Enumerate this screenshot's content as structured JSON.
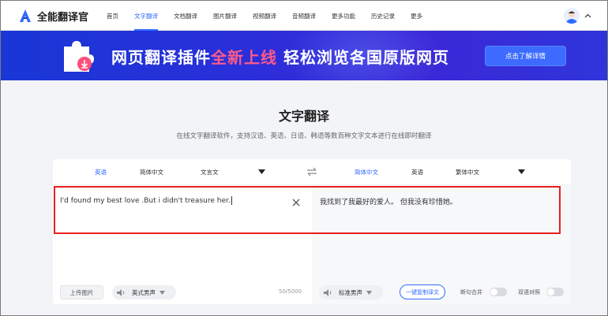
{
  "app": {
    "name": "全能翻译官"
  },
  "nav": {
    "items": [
      {
        "label": "首页",
        "active": false
      },
      {
        "label": "文字翻译",
        "active": true
      },
      {
        "label": "文档翻译",
        "active": false
      },
      {
        "label": "图片翻译",
        "active": false
      },
      {
        "label": "视频翻译",
        "active": false
      },
      {
        "label": "音频翻译",
        "active": false
      },
      {
        "label": "更多功能",
        "active": false
      },
      {
        "label": "历史记录",
        "active": false
      },
      {
        "label": "更多",
        "active": false
      }
    ]
  },
  "banner": {
    "text_part1": "网页翻译插件",
    "text_highlight": "全新上线",
    "text_part2": " 轻松浏览各国原版网页",
    "button_label": "点击了解详情",
    "highlight_color": "#ff5a8a"
  },
  "page": {
    "title": "文字翻译",
    "subtitle": "在线文字翻译软件，支持汉语、英语、日语、韩语等数百种文字文本进行在线即时翻译"
  },
  "translator": {
    "source_langs": [
      "英语",
      "简体中文",
      "文言文"
    ],
    "target_langs": [
      "简体中文",
      "英语",
      "繁体中文"
    ],
    "source_text": "I'd found my best love .But i didn't treasure her.",
    "target_text": "我找到了我最好的爱人。 但我没有珍惜她。",
    "upload_label": "上传图片",
    "source_voice": "英式男声",
    "char_count": "50/5000",
    "target_voice": "标准男声",
    "compare_label": "一键复制译文",
    "toggle_split": "断句合并",
    "toggle_bilingual": "双语对照"
  },
  "colors": {
    "accent": "#2f6bff",
    "highlight_border": "#e8201d"
  }
}
